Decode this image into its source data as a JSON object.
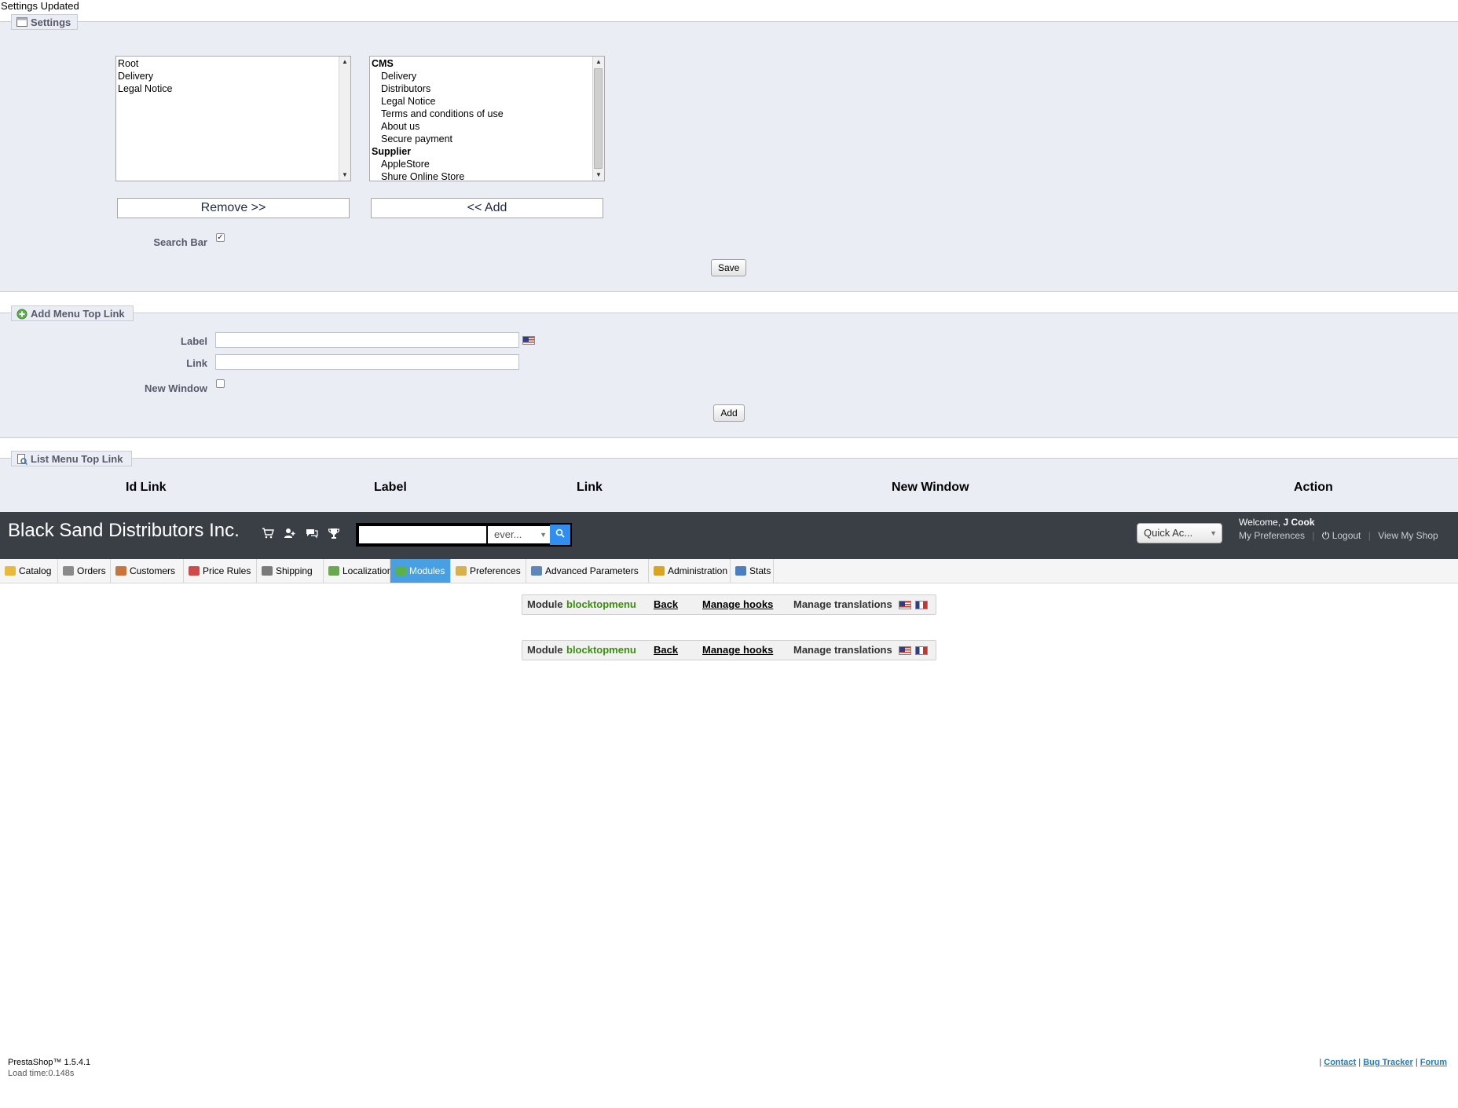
{
  "top_message": "Settings Updated",
  "settings": {
    "legend": "Settings",
    "selected_items": [
      "Root",
      "Delivery",
      "Legal Notice"
    ],
    "available_items": [
      {
        "label": "CMS",
        "group": true
      },
      {
        "label": "Delivery",
        "group": false
      },
      {
        "label": "Distributors",
        "group": false
      },
      {
        "label": "Legal Notice",
        "group": false
      },
      {
        "label": "Terms and conditions of use",
        "group": false
      },
      {
        "label": "About us",
        "group": false
      },
      {
        "label": "Secure payment",
        "group": false
      },
      {
        "label": "Supplier",
        "group": true
      },
      {
        "label": "AppleStore",
        "group": false
      },
      {
        "label": "Shure Online Store",
        "group": false
      }
    ],
    "remove_label": "Remove >>",
    "add_label": "<< Add",
    "search_bar_label": "Search Bar",
    "search_bar_checked": true,
    "save_label": "Save"
  },
  "add_link": {
    "legend": "Add Menu Top Link",
    "label_label": "Label",
    "link_label": "Link",
    "new_window_label": "New Window",
    "new_window_checked": false,
    "add_label": "Add"
  },
  "list_links": {
    "legend": "List Menu Top Link",
    "columns": [
      "Id Link",
      "Label",
      "Link",
      "New Window",
      "Action"
    ]
  },
  "header": {
    "shop_name": "Black Sand Distributors Inc.",
    "search_scope": "ever...",
    "quick_access": "Quick Ac...",
    "welcome_prefix": "Welcome,",
    "user_name": "J Cook",
    "my_preferences": "My Preferences",
    "logout": "Logout",
    "view_shop": "View My Shop"
  },
  "tabs": [
    {
      "label": "Catalog",
      "active": false
    },
    {
      "label": "Orders",
      "active": false
    },
    {
      "label": "Customers",
      "active": false
    },
    {
      "label": "Price Rules",
      "active": false
    },
    {
      "label": "Shipping",
      "active": false
    },
    {
      "label": "Localization",
      "active": false
    },
    {
      "label": "Modules",
      "active": true
    },
    {
      "label": "Preferences",
      "active": false
    },
    {
      "label": "Advanced Parameters",
      "active": false
    },
    {
      "label": "Administration",
      "active": false
    },
    {
      "label": "Stats",
      "active": false
    }
  ],
  "module_toolbar": {
    "module_prefix": "Module",
    "module_name": "blocktopmenu",
    "back": "Back",
    "manage_hooks": "Manage hooks",
    "manage_translations": "Manage translations"
  },
  "footer": {
    "version": "PrestaShop™ 1.5.4.1",
    "load_time": "Load time:0.148s",
    "contact": "Contact",
    "bug_tracker": "Bug Tracker",
    "forum": "Forum"
  },
  "colors": {
    "panel_bg": "#ebedf4",
    "header_bg": "#393f45",
    "active_tab": "#48a0e2",
    "module_name": "#3b8f0c"
  }
}
